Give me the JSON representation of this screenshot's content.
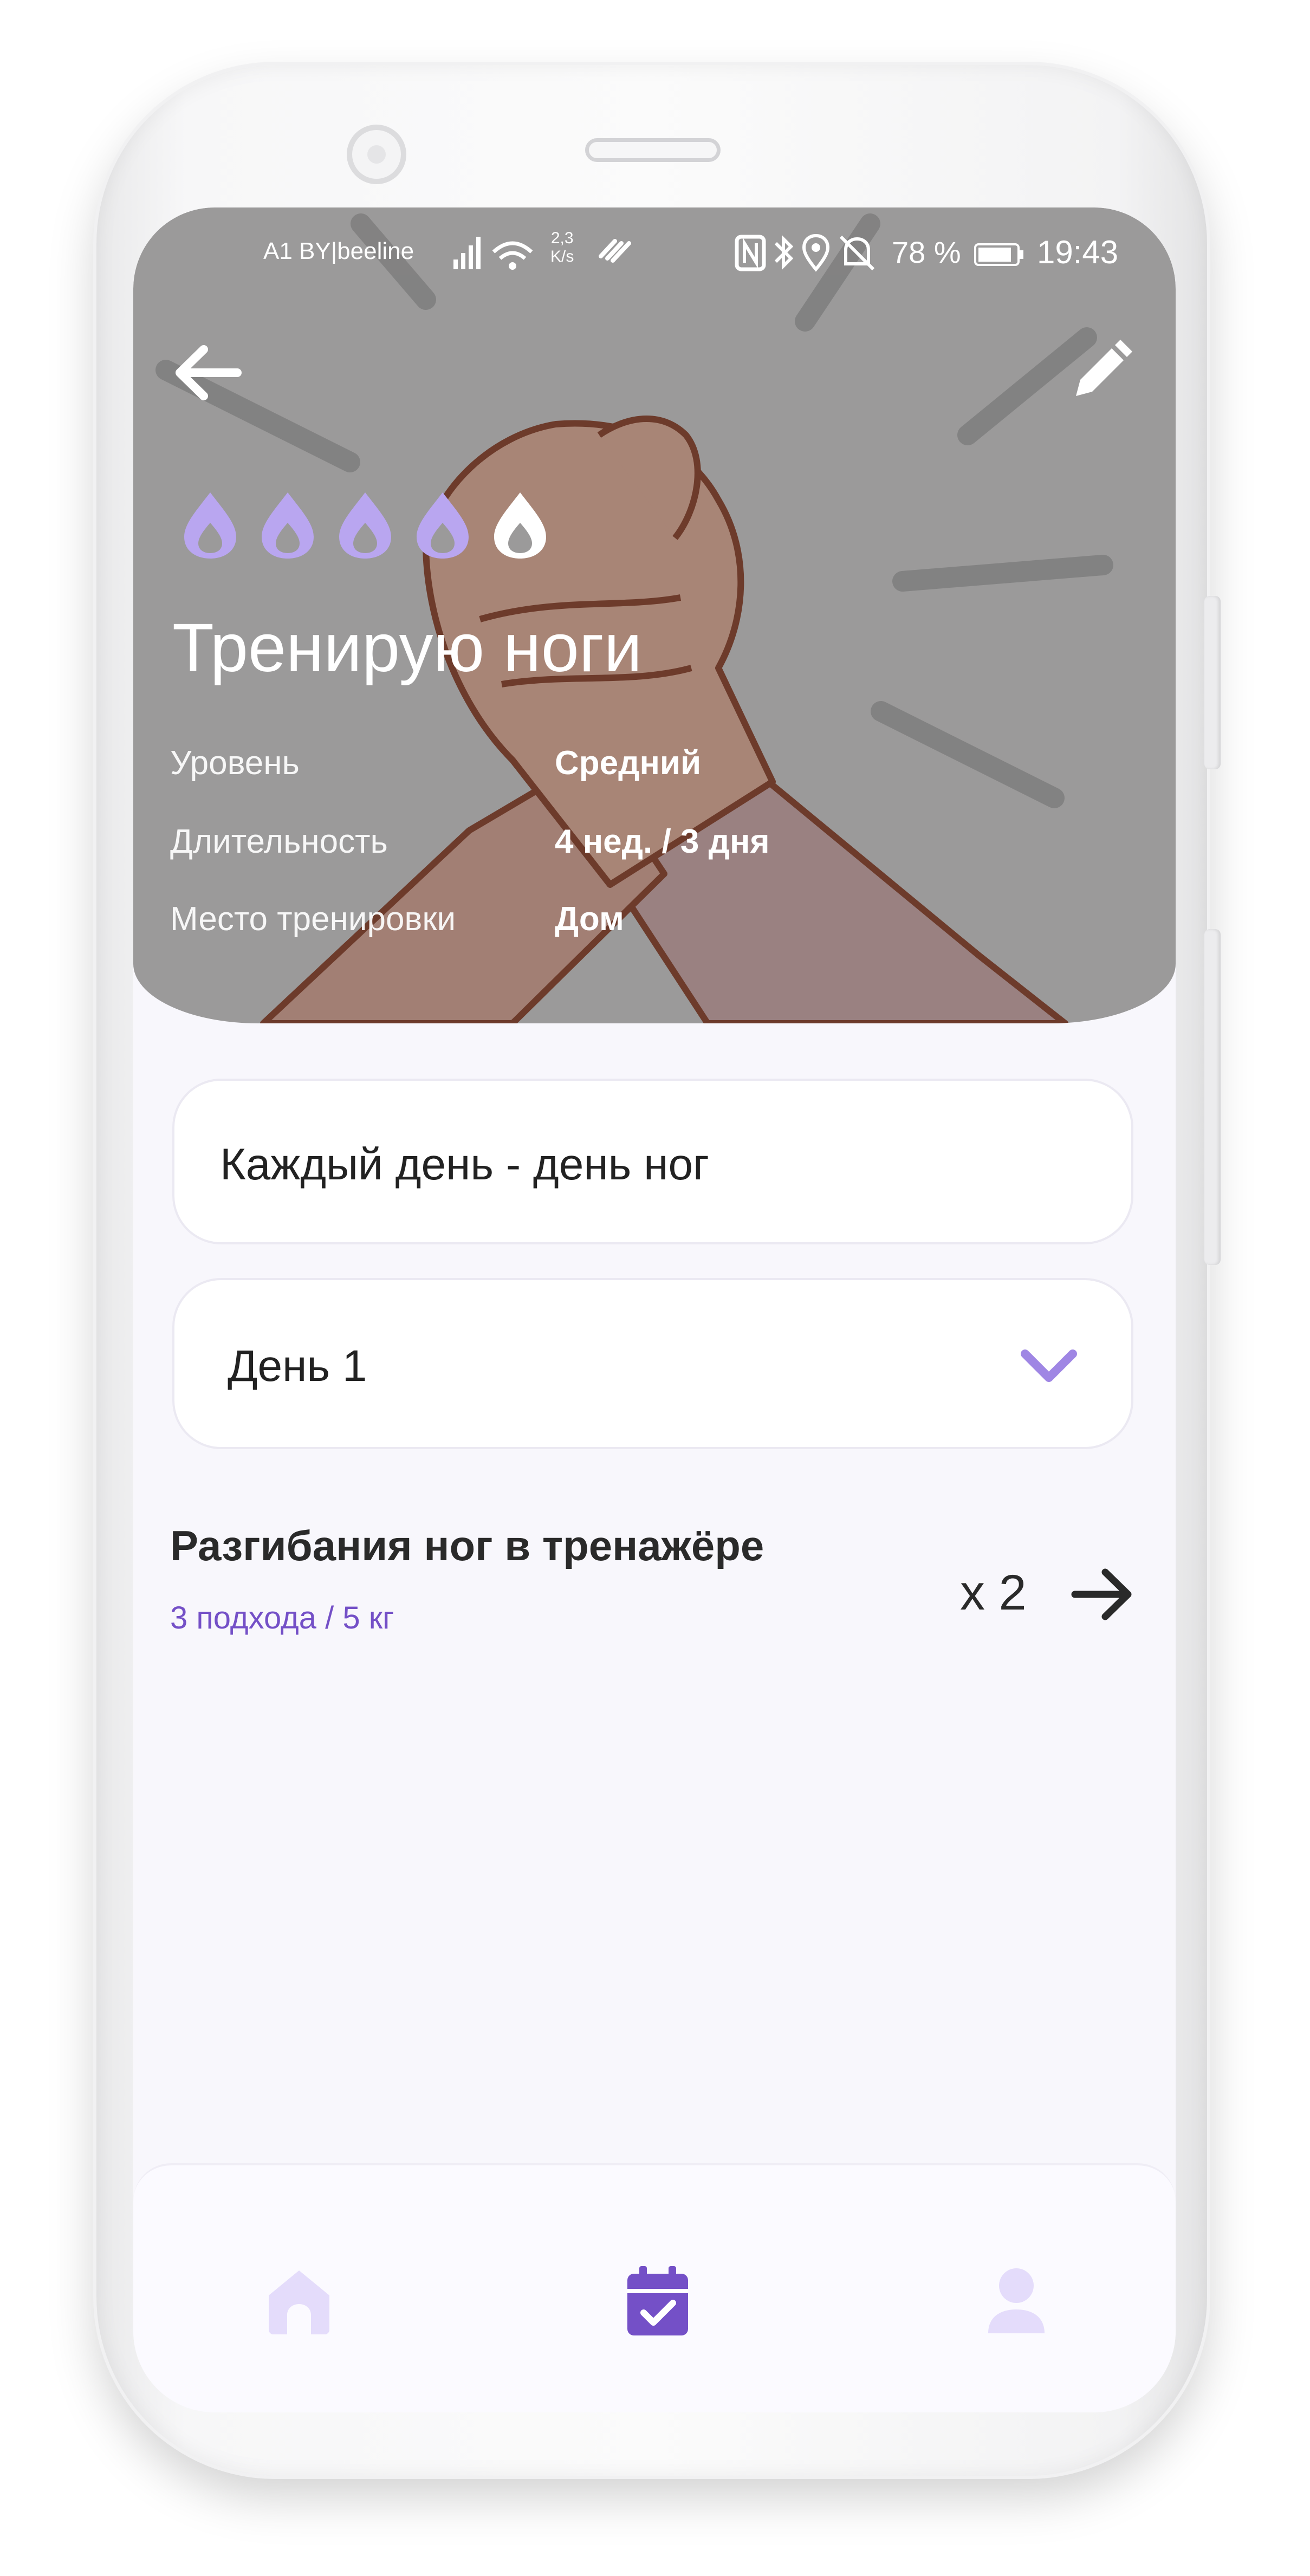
{
  "statusbar": {
    "carrier": "A1 BY|beeline",
    "net_speed_value": "2,3",
    "net_speed_unit": "K/s",
    "battery_percent": "78 %",
    "time": "19:43"
  },
  "header": {
    "back_icon": "arrow-left-icon",
    "edit_icon": "pencil-icon",
    "intensity_total": 5,
    "intensity_filled": 4,
    "title": "Тренирую ноги",
    "info": [
      {
        "label": "Уровень",
        "value": "Средний"
      },
      {
        "label": "Длительность",
        "value": "4 нед. / 3 дня"
      },
      {
        "label": "Место тренировки",
        "value": "Дом"
      }
    ]
  },
  "program": {
    "name": "Каждый день - день ног",
    "day_select_value": "День 1"
  },
  "exercises": [
    {
      "name": "Разгибания ног в тренажёре",
      "details": "3 подхода / 5 кг",
      "multiplier": "x 2"
    }
  ],
  "bottom_nav": {
    "items": [
      {
        "icon": "home-icon",
        "active": false
      },
      {
        "icon": "calendar-check-icon",
        "active": true
      },
      {
        "icon": "user-icon",
        "active": false
      }
    ]
  },
  "colors": {
    "accent": "#7450c7",
    "accent_light": "#c2b3f2",
    "hero_overlay": "#9b9a9a",
    "background": "#f8f7fc"
  }
}
